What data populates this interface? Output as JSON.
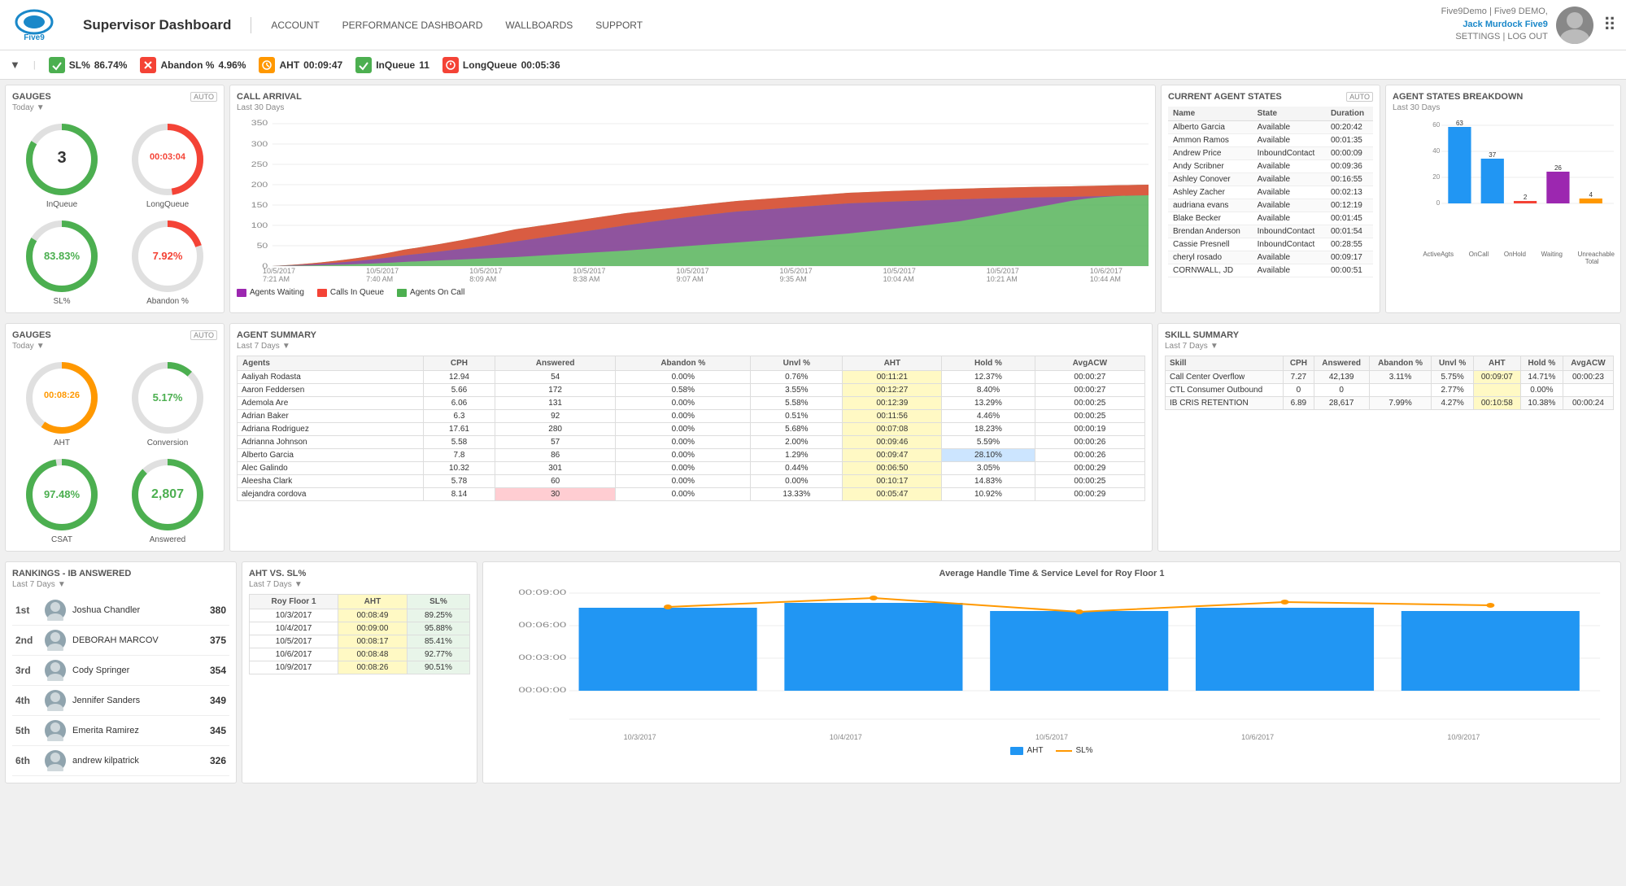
{
  "header": {
    "title": "Supervisor Dashboard",
    "nav": [
      "ACCOUNT",
      "PERFORMANCE DASHBOARD",
      "WALLBOARDS",
      "SUPPORT"
    ],
    "user": {
      "top": "Five9Demo | Five9 DEMO,",
      "name": "Jack Murdock Five9",
      "bottom": "SETTINGS | LOG OUT"
    }
  },
  "statusBar": {
    "items": [
      {
        "label": "SL%",
        "value": "86.74%",
        "iconType": "green"
      },
      {
        "label": "Abandon %",
        "value": "4.96%",
        "iconType": "red"
      },
      {
        "label": "AHT",
        "value": "00:09:47",
        "iconType": "orange"
      },
      {
        "label": "InQueue",
        "value": "11",
        "iconType": "green"
      },
      {
        "label": "LongQueue",
        "value": "00:05:36",
        "iconType": "red"
      }
    ]
  },
  "gauges1": {
    "title": "GAUGES",
    "subtitle": "Today",
    "badge": "AUTO",
    "items": [
      {
        "label": "InQueue",
        "value": "3",
        "color": "#4caf50",
        "type": "number"
      },
      {
        "label": "LongQueue",
        "value": "00:03:04",
        "color": "#f44336",
        "type": "time"
      },
      {
        "label": "SL%",
        "value": "83.83%",
        "color": "#4caf50",
        "type": "percent"
      },
      {
        "label": "Abandon %",
        "value": "7.92%",
        "color": "#f44336",
        "type": "percent"
      }
    ]
  },
  "gauges2": {
    "title": "GAUGES",
    "subtitle": "Today",
    "badge": "AUTO",
    "items": [
      {
        "label": "AHT",
        "value": "00:08:26",
        "color": "#ff9800",
        "type": "time"
      },
      {
        "label": "Conversion",
        "value": "5.17%",
        "color": "#4caf50",
        "type": "percent"
      },
      {
        "label": "CSAT",
        "value": "97.48%",
        "color": "#4caf50",
        "type": "percent"
      },
      {
        "label": "Answered",
        "value": "2,807",
        "color": "#4caf50",
        "type": "number"
      }
    ]
  },
  "callArrival": {
    "title": "CALL ARRIVAL",
    "subtitle": "Last 30 Days",
    "yMax": 350,
    "legend": [
      {
        "label": "Agents Waiting",
        "color": "#9c27b0"
      },
      {
        "label": "Calls In Queue",
        "color": "#f44336"
      },
      {
        "label": "Agents On Call",
        "color": "#4caf50"
      }
    ]
  },
  "agentSummary": {
    "title": "AGENT SUMMARY",
    "subtitle": "Last 7 Days",
    "columns": [
      "Agents",
      "CPH",
      "Answered",
      "Abandon %",
      "Unvl %",
      "AHT",
      "Hold %",
      "AvgACW"
    ],
    "rows": [
      {
        "name": "Aaliyah Rodasta",
        "cph": "12.94",
        "answered": "54",
        "abandon": "0.00%",
        "unvl": "0.76%",
        "aht": "00:11:21",
        "hold": "12.37%",
        "avgacw": "00:00:27"
      },
      {
        "name": "Aaron Feddersen",
        "cph": "5.66",
        "answered": "172",
        "abandon": "0.58%",
        "unvl": "3.55%",
        "aht": "00:12:27",
        "hold": "8.40%",
        "avgacw": "00:00:27"
      },
      {
        "name": "Ademola Are",
        "cph": "6.06",
        "answered": "131",
        "abandon": "0.00%",
        "unvl": "5.58%",
        "aht": "00:12:39",
        "hold": "13.29%",
        "avgacw": "00:00:25"
      },
      {
        "name": "Adrian Baker",
        "cph": "6.3",
        "answered": "92",
        "abandon": "0.00%",
        "unvl": "0.51%",
        "aht": "00:11:56",
        "hold": "4.46%",
        "avgacw": "00:00:25"
      },
      {
        "name": "Adriana Rodriguez",
        "cph": "17.61",
        "answered": "280",
        "abandon": "0.00%",
        "unvl": "5.68%",
        "aht": "00:07:08",
        "hold": "18.23%",
        "avgacw": "00:00:19"
      },
      {
        "name": "Adrianna Johnson",
        "cph": "5.58",
        "answered": "57",
        "abandon": "0.00%",
        "unvl": "2.00%",
        "aht": "00:09:46",
        "hold": "5.59%",
        "avgacw": "00:00:26"
      },
      {
        "name": "Alberto Garcia",
        "cph": "7.8",
        "answered": "86",
        "abandon": "0.00%",
        "unvl": "1.29%",
        "aht": "00:09:47",
        "hold": "28.10%",
        "avgacw": "00:00:26"
      },
      {
        "name": "Alec Galindo",
        "cph": "10.32",
        "answered": "301",
        "abandon": "0.00%",
        "unvl": "0.44%",
        "aht": "00:06:50",
        "hold": "3.05%",
        "avgacw": "00:00:29"
      },
      {
        "name": "Aleesha Clark",
        "cph": "5.78",
        "answered": "60",
        "abandon": "0.00%",
        "unvl": "0.00%",
        "aht": "00:10:17",
        "hold": "14.83%",
        "avgacw": "00:00:25"
      },
      {
        "name": "alejandra cordova",
        "cph": "8.14",
        "answered": "30",
        "abandon": "0.00%",
        "unvl": "13.33%",
        "aht": "00:05:47",
        "hold": "10.92%",
        "avgacw": "00:00:29",
        "highlightAnswered": true
      }
    ]
  },
  "currentAgentStates": {
    "title": "CURRENT AGENT STATES",
    "badge": "AUTO",
    "columns": [
      "Name",
      "State",
      "Duration"
    ],
    "rows": [
      {
        "name": "Alberto Garcia",
        "state": "Available",
        "duration": "00:20:42"
      },
      {
        "name": "Ammon Ramos",
        "state": "Available",
        "duration": "00:01:35"
      },
      {
        "name": "Andrew Price",
        "state": "InboundContact",
        "duration": "00:00:09"
      },
      {
        "name": "Andy Scribner",
        "state": "Available",
        "duration": "00:09:36"
      },
      {
        "name": "Ashley Conover",
        "state": "Available",
        "duration": "00:16:55"
      },
      {
        "name": "Ashley Zacher",
        "state": "Available",
        "duration": "00:02:13"
      },
      {
        "name": "audriana evans",
        "state": "Available",
        "duration": "00:12:19"
      },
      {
        "name": "Blake Becker",
        "state": "Available",
        "duration": "00:01:45"
      },
      {
        "name": "Brendan Anderson",
        "state": "InboundContact",
        "duration": "00:01:54"
      },
      {
        "name": "Cassie Presnell",
        "state": "InboundContact",
        "duration": "00:28:55"
      },
      {
        "name": "cheryl rosado",
        "state": "Available",
        "duration": "00:09:17"
      },
      {
        "name": "CORNWALL, JD",
        "state": "Available",
        "duration": "00:00:51"
      }
    ]
  },
  "agentStatesBreakdown": {
    "title": "AGENT STATES BREAKDOWN",
    "subtitle": "Last 30 Days",
    "bars": [
      {
        "label": "ActiveAgts",
        "value": 63,
        "color": "#2196f3"
      },
      {
        "label": "OnCall",
        "value": 37,
        "color": "#2196f3"
      },
      {
        "label": "OnHold",
        "value": 2,
        "color": "#f44336"
      },
      {
        "label": "Waiting",
        "value": 26,
        "color": "#9c27b0"
      },
      {
        "label": "Unreachable Total",
        "value": 4,
        "color": "#ff9800"
      }
    ],
    "yMax": 70
  },
  "skillSummary": {
    "title": "SKILL SUMMARY",
    "subtitle": "Last 7 Days",
    "columns": [
      "Skill",
      "CPH",
      "Answered",
      "Abandon %",
      "Unvl %",
      "AHT",
      "Hold %",
      "AvgACW"
    ],
    "rows": [
      {
        "skill": "Call Center Overflow",
        "cph": "7.27",
        "answered": "42,139",
        "abandon": "3.11%",
        "unvl": "5.75%",
        "aht": "00:09:07",
        "hold": "14.71%",
        "avgacw": "00:00:23"
      },
      {
        "skill": "CTL Consumer Outbound",
        "cph": "0",
        "answered": "0",
        "abandon": "",
        "unvl": "2.77%",
        "aht": "",
        "hold": "0.00%",
        "avgacw": ""
      },
      {
        "skill": "IB CRIS RETENTION",
        "cph": "6.89",
        "answered": "28,617",
        "abandon": "7.99%",
        "unvl": "4.27%",
        "aht": "00:10:58",
        "hold": "10.38%",
        "avgacw": "00:00:24"
      }
    ]
  },
  "rankings": {
    "title": "RANKINGS - IB ANSWERED",
    "subtitle": "Last 7 Days",
    "items": [
      {
        "rank": "1st",
        "name": "Joshua Chandler",
        "score": 380
      },
      {
        "rank": "2nd",
        "name": "DEBORAH MARCOV",
        "score": 375
      },
      {
        "rank": "3rd",
        "name": "Cody Springer",
        "score": 354
      },
      {
        "rank": "4th",
        "name": "Jennifer Sanders",
        "score": 349
      },
      {
        "rank": "5th",
        "name": "Emerita Ramirez",
        "score": 345
      },
      {
        "rank": "6th",
        "name": "andrew kilpatrick",
        "score": 326
      }
    ]
  },
  "ahtVsSL": {
    "title": "AHT VS. SL%",
    "subtitle": "Last 7 Days",
    "groupLabel": "Roy Floor 1",
    "columns": [
      "Roy Floor 1",
      "AHT",
      "SL%"
    ],
    "rows": [
      {
        "date": "10/3/2017",
        "aht": "00:08:49",
        "sl": "89.25%",
        "slHigh": true
      },
      {
        "date": "10/4/2017",
        "aht": "00:09:00",
        "sl": "95.88%",
        "slHigh": true
      },
      {
        "date": "10/5/2017",
        "aht": "00:08:17",
        "sl": "85.41%",
        "slHigh": true
      },
      {
        "date": "10/6/2017",
        "aht": "00:08:48",
        "sl": "92.77%",
        "slHigh": true
      },
      {
        "date": "10/9/2017",
        "aht": "00:08:26",
        "sl": "90.51%",
        "slHigh": true
      }
    ],
    "chartTitle": "Average Handle Time & Service Level for Roy Floor 1",
    "chartLegend": [
      {
        "label": "AHT",
        "color": "#2196f3"
      },
      {
        "label": "SL%",
        "color": "#ff9800"
      }
    ]
  }
}
